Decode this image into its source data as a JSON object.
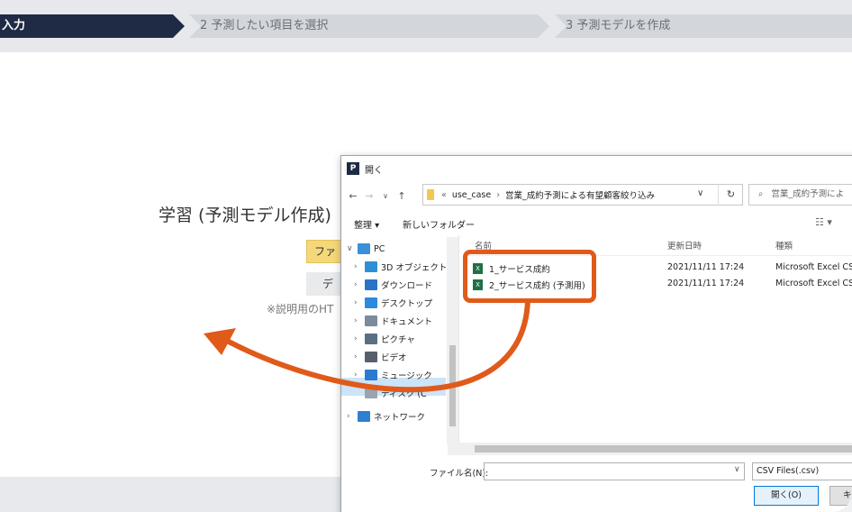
{
  "steps": [
    "入力",
    "2 予測したい項目を選択",
    "3 予測モデルを作成"
  ],
  "main": {
    "title": "学習 (予測モデル作成)",
    "file_button": "ファ",
    "demo_button": "デ",
    "note": "※説明用のHT"
  },
  "dialog": {
    "app_icon": "P",
    "title": "開く",
    "nav_back": "←",
    "nav_forward": "→",
    "nav_recent": "∨",
    "nav_up": "↑",
    "breadcrumb_prefix": "«",
    "breadcrumb": [
      "use_case",
      "営業_成約予測による有望顧客絞り込み"
    ],
    "breadcrumb_sep": "›",
    "address_dropdown": "∨",
    "refresh": "↻",
    "search_placeholder": "営業_成約予測によ",
    "search_icon": "⌕",
    "organize": "整理 ▾",
    "new_folder": "新しいフォルダー",
    "view_toggle": "☷ ▾",
    "nav_tree": [
      {
        "chev": "∨",
        "label": "PC",
        "icon": "pc-icon",
        "color": "#3a8fd8"
      },
      {
        "chev": "›",
        "label": "3D オブジェクト",
        "icon": "3d-objects-icon",
        "color": "#2e8fd6"
      },
      {
        "chev": "›",
        "label": "ダウンロード",
        "icon": "download-icon",
        "color": "#2a72c8"
      },
      {
        "chev": "›",
        "label": "デスクトップ",
        "icon": "desktop-icon",
        "color": "#2a8ae0"
      },
      {
        "chev": "›",
        "label": "ドキュメント",
        "icon": "documents-icon",
        "color": "#7a8b9c"
      },
      {
        "chev": "›",
        "label": "ピクチャ",
        "icon": "pictures-icon",
        "color": "#5a6f84"
      },
      {
        "chev": "›",
        "label": "ビデオ",
        "icon": "videos-icon",
        "color": "#56606a"
      },
      {
        "chev": "›",
        "label": "ミュージック",
        "icon": "music-icon",
        "color": "#2a7ad0"
      },
      {
        "chev": "",
        "label": "ディスク (C",
        "icon": "disk-icon",
        "color": "#9aa4ae"
      },
      {
        "chev": "›",
        "label": "ネットワーク",
        "icon": "network-icon",
        "color": "#2f7fd0"
      }
    ],
    "columns": {
      "name": "名前",
      "date": "更新日時",
      "type": "種類"
    },
    "files": [
      {
        "name": "1_サービス成約",
        "date": "2021/11/11 17:24",
        "type": "Microsoft Excel CS..."
      },
      {
        "name": "2_サービス成約 (予測用)",
        "date": "2021/11/11 17:24",
        "type": "Microsoft Excel CS..."
      }
    ],
    "file_name_label": "ファイル名(N):",
    "file_name_value": "",
    "file_type": "CSV Files(.csv)",
    "open_button": "開く(O)",
    "cancel_button": "キ"
  },
  "colors": {
    "accent_navy": "#1f2a44",
    "annotation_orange": "#e05a1a",
    "file_button_yellow": "#f5d87a",
    "excel_green": "#1e7145"
  }
}
